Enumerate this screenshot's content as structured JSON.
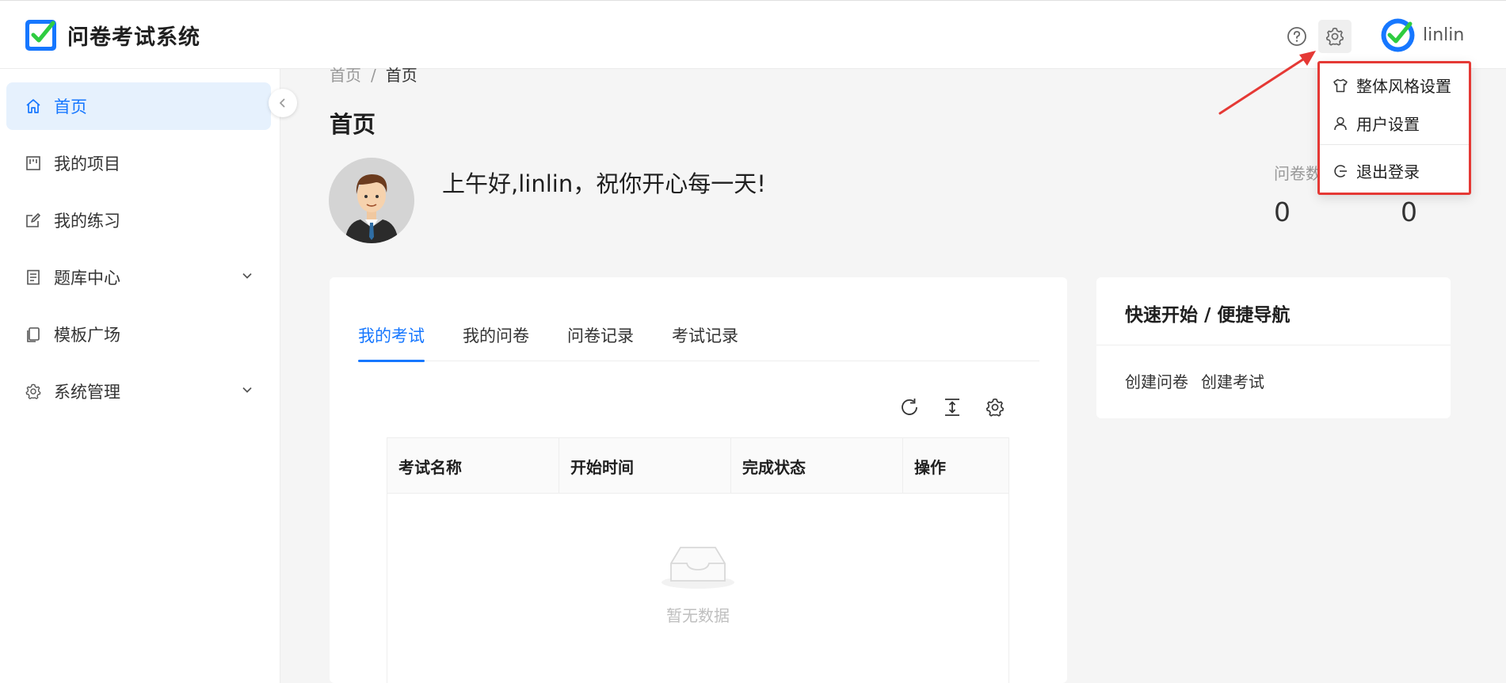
{
  "app": {
    "title": "问卷考试系统",
    "brand_color": "#1677ff",
    "accent_green": "#2ecc40"
  },
  "header": {
    "icons": [
      "question-circle-icon",
      "gear-icon"
    ],
    "username": "linlin"
  },
  "user_menu": {
    "items": [
      {
        "label": "整体风格设置",
        "icon": "shirt-icon"
      },
      {
        "label": "用户设置",
        "icon": "user-icon"
      },
      {
        "label": "退出登录",
        "icon": "logout-icon"
      }
    ]
  },
  "sidebar": {
    "items": [
      {
        "label": "首页",
        "icon": "home-icon",
        "active": true
      },
      {
        "label": "我的项目",
        "icon": "project-icon"
      },
      {
        "label": "我的练习",
        "icon": "edit-icon"
      },
      {
        "label": "题库中心",
        "icon": "book-icon",
        "expandable": true
      },
      {
        "label": "模板广场",
        "icon": "copy-icon"
      },
      {
        "label": "系统管理",
        "icon": "gear-icon",
        "expandable": true
      }
    ]
  },
  "breadcrumb": {
    "items": [
      "首页",
      "首页"
    ],
    "separator": "/"
  },
  "main": {
    "page_title": "首页",
    "greeting": "上午好,linlin，祝你开心每一天!",
    "stats": [
      {
        "label": "问卷数",
        "value": "0"
      },
      {
        "label": "",
        "value": "0"
      }
    ],
    "stat_visible_label": "问卷数"
  },
  "tabs": {
    "items": [
      "我的考试",
      "我的问卷",
      "问卷记录",
      "考试记录"
    ],
    "active_index": 0
  },
  "table": {
    "toolbar_icons": [
      "reload-icon",
      "column-height-icon",
      "setting-icon"
    ],
    "columns": [
      "考试名称",
      "开始时间",
      "完成状态",
      "操作"
    ],
    "rows": [],
    "empty_text": "暂无数据"
  },
  "quick_nav": {
    "title": "快速开始 / 便捷导航",
    "links": [
      "创建问卷",
      "创建考试"
    ]
  }
}
